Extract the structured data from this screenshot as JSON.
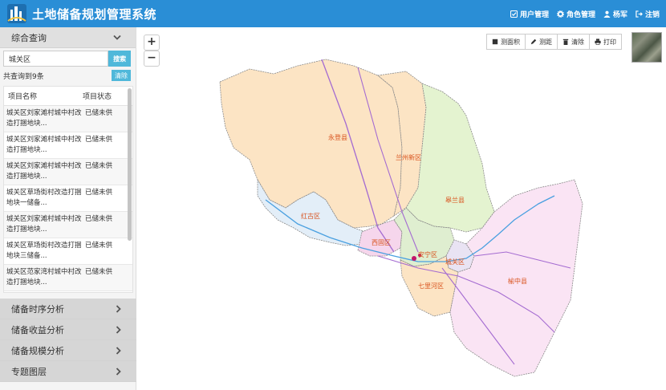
{
  "header": {
    "app_title": "土地储备规划管理系统",
    "nav": [
      {
        "label": "用户管理",
        "icon": "check-square-icon"
      },
      {
        "label": "角色管理",
        "icon": "gear-icon"
      },
      {
        "label": "杨军",
        "icon": "user-icon"
      },
      {
        "label": "注销",
        "icon": "logout-icon"
      }
    ]
  },
  "sidebar": {
    "query_section": "综合查询",
    "search": {
      "value": "城关区",
      "button": "搜索"
    },
    "result_count": "共查询到9条",
    "clear_button": "清除",
    "table": {
      "headers": [
        "项目名称",
        "项目状态"
      ],
      "rows": [
        {
          "name": "城关区刘家滩村城中村改造打捆地块...",
          "status": "已储未供"
        },
        {
          "name": "城关区刘家滩村城中村改造打捆地块...",
          "status": "已储未供"
        },
        {
          "name": "城关区刘家滩村城中村改造打捆地块...",
          "status": "已储未供"
        },
        {
          "name": "城关区草场街村改造打捆地块一储备...",
          "status": "已储未供"
        },
        {
          "name": "城关区刘家滩村城中村改造打捆地块...",
          "status": "已储未供"
        },
        {
          "name": "城关区草场街村改造打捆地块三储备...",
          "status": "已储未供"
        },
        {
          "name": "城关区范家湾村城中村改造打捆地块...",
          "status": "已储未供"
        }
      ]
    },
    "sections": [
      "储备时序分析",
      "储备收益分析",
      "储备规模分析",
      "专题图层"
    ]
  },
  "map": {
    "zoom_in": "+",
    "zoom_out": "−",
    "tools": [
      {
        "label": "测面积",
        "icon": "area-icon"
      },
      {
        "label": "测距",
        "icon": "pencil-icon"
      },
      {
        "label": "清除",
        "icon": "trash-icon"
      },
      {
        "label": "打印",
        "icon": "print-icon"
      }
    ],
    "districts": [
      "永登县",
      "兰州新区",
      "皋兰县",
      "红古区",
      "西固区",
      "安宁区",
      "城关区",
      "七里河区",
      "榆中县"
    ]
  }
}
